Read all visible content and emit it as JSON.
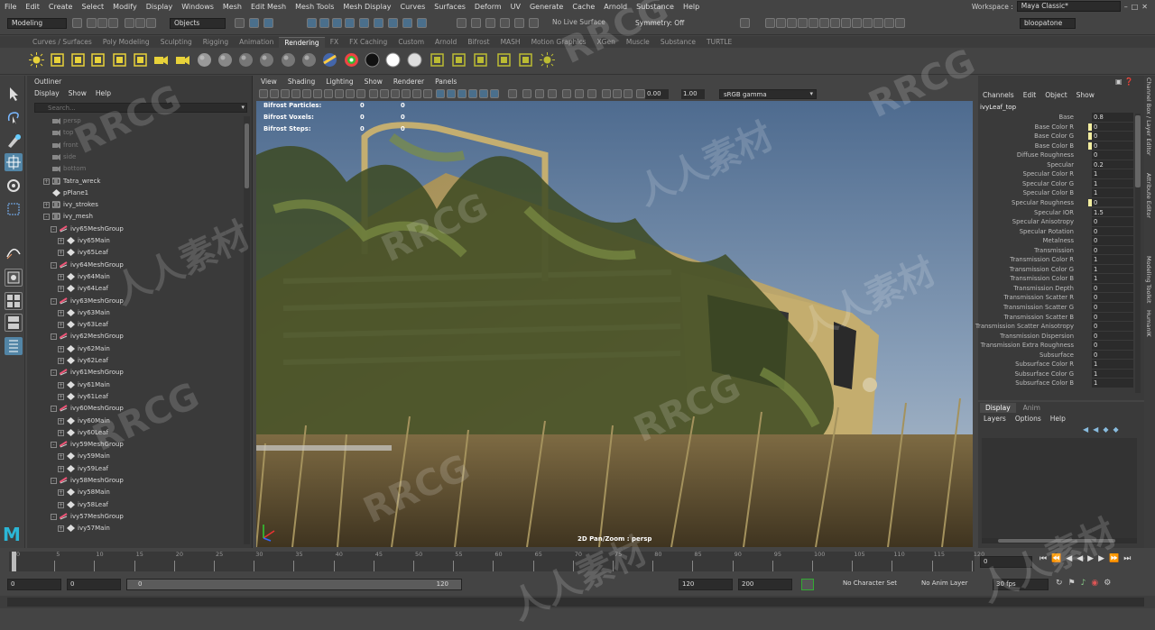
{
  "menus": [
    "File",
    "Edit",
    "Create",
    "Select",
    "Modify",
    "Display",
    "Windows",
    "Mesh",
    "Edit Mesh",
    "Mesh Tools",
    "Mesh Display",
    "Curves",
    "Surfaces",
    "Deform",
    "UV",
    "Generate",
    "Cache",
    "Arnold",
    "Substance",
    "Help"
  ],
  "workspace": {
    "label": "Workspace :",
    "value": "Maya Classic*"
  },
  "status": {
    "mode": "Modeling",
    "objects": "Objects",
    "live_surface": "No Live Surface",
    "symmetry": "Symmetry: Off",
    "user": "bloopatone"
  },
  "shelf_tabs": [
    "Curves / Surfaces",
    "Poly Modeling",
    "Sculpting",
    "Rigging",
    "Animation",
    "Rendering",
    "FX",
    "FX Caching",
    "Custom",
    "Arnold",
    "Bifrost",
    "MASH",
    "Motion Graphics",
    "XGen",
    "Muscle",
    "Substance",
    "TURTLE"
  ],
  "active_shelf_tab": "Rendering",
  "outliner": {
    "title": "Outliner",
    "menus": [
      "Display",
      "Show",
      "Help"
    ],
    "search_placeholder": "Search...",
    "items": [
      {
        "label": "persp",
        "depth": 0,
        "kind": "camera",
        "dim": true
      },
      {
        "label": "top",
        "depth": 0,
        "kind": "camera",
        "dim": true
      },
      {
        "label": "front",
        "depth": 0,
        "kind": "camera",
        "dim": true
      },
      {
        "label": "side",
        "depth": 0,
        "kind": "camera",
        "dim": true
      },
      {
        "label": "bottom",
        "depth": 0,
        "kind": "camera",
        "dim": true
      },
      {
        "label": "Tatra_wreck",
        "depth": 0,
        "kind": "group",
        "exp": "+"
      },
      {
        "label": "pPlane1",
        "depth": 0,
        "kind": "mesh"
      },
      {
        "label": "ivy_strokes",
        "depth": 0,
        "kind": "group",
        "exp": "+"
      },
      {
        "label": "ivy_mesh",
        "depth": 0,
        "kind": "group",
        "exp": "-"
      },
      {
        "label": "ivy65MeshGroup",
        "depth": 1,
        "kind": "meshgroup",
        "exp": "-"
      },
      {
        "label": "ivy65Main",
        "depth": 2,
        "kind": "mesh",
        "exp": "+"
      },
      {
        "label": "ivy65Leaf",
        "depth": 2,
        "kind": "mesh",
        "exp": "+"
      },
      {
        "label": "ivy64MeshGroup",
        "depth": 1,
        "kind": "meshgroup",
        "exp": "-"
      },
      {
        "label": "ivy64Main",
        "depth": 2,
        "kind": "mesh",
        "exp": "+"
      },
      {
        "label": "ivy64Leaf",
        "depth": 2,
        "kind": "mesh",
        "exp": "+"
      },
      {
        "label": "ivy63MeshGroup",
        "depth": 1,
        "kind": "meshgroup",
        "exp": "-"
      },
      {
        "label": "ivy63Main",
        "depth": 2,
        "kind": "mesh",
        "exp": "+"
      },
      {
        "label": "ivy63Leaf",
        "depth": 2,
        "kind": "mesh",
        "exp": "+"
      },
      {
        "label": "ivy62MeshGroup",
        "depth": 1,
        "kind": "meshgroup",
        "exp": "-"
      },
      {
        "label": "ivy62Main",
        "depth": 2,
        "kind": "mesh",
        "exp": "+"
      },
      {
        "label": "ivy62Leaf",
        "depth": 2,
        "kind": "mesh",
        "exp": "+"
      },
      {
        "label": "ivy61MeshGroup",
        "depth": 1,
        "kind": "meshgroup",
        "exp": "-"
      },
      {
        "label": "ivy61Main",
        "depth": 2,
        "kind": "mesh",
        "exp": "+"
      },
      {
        "label": "ivy61Leaf",
        "depth": 2,
        "kind": "mesh",
        "exp": "+"
      },
      {
        "label": "ivy60MeshGroup",
        "depth": 1,
        "kind": "meshgroup",
        "exp": "-"
      },
      {
        "label": "ivy60Main",
        "depth": 2,
        "kind": "mesh",
        "exp": "+"
      },
      {
        "label": "ivy60Leaf",
        "depth": 2,
        "kind": "mesh",
        "exp": "+"
      },
      {
        "label": "ivy59MeshGroup",
        "depth": 1,
        "kind": "meshgroup",
        "exp": "-"
      },
      {
        "label": "ivy59Main",
        "depth": 2,
        "kind": "mesh",
        "exp": "+"
      },
      {
        "label": "ivy59Leaf",
        "depth": 2,
        "kind": "mesh",
        "exp": "+"
      },
      {
        "label": "ivy58MeshGroup",
        "depth": 1,
        "kind": "meshgroup",
        "exp": "-"
      },
      {
        "label": "ivy58Main",
        "depth": 2,
        "kind": "mesh",
        "exp": "+"
      },
      {
        "label": "ivy58Leaf",
        "depth": 2,
        "kind": "mesh",
        "exp": "+"
      },
      {
        "label": "ivy57MeshGroup",
        "depth": 1,
        "kind": "meshgroup",
        "exp": "-"
      },
      {
        "label": "ivy57Main",
        "depth": 2,
        "kind": "mesh",
        "exp": "+"
      }
    ]
  },
  "viewport": {
    "menus": [
      "View",
      "Shading",
      "Lighting",
      "Show",
      "Renderer",
      "Panels"
    ],
    "value_a": "0.00",
    "value_b": "1.00",
    "color_space": "sRGB gamma",
    "hud": [
      {
        "label": "Bifrost Particles:",
        "v1": "0",
        "v2": "0"
      },
      {
        "label": "Bifrost Voxels:",
        "v1": "0",
        "v2": "0"
      },
      {
        "label": "Bifrost Steps:",
        "v1": "0",
        "v2": "0"
      }
    ],
    "camera_label": "2D Pan/Zoom : persp"
  },
  "channel_box": {
    "menus": [
      "Channels",
      "Edit",
      "Object",
      "Show"
    ],
    "object": "ivyLeaf_top",
    "rows": [
      {
        "name": "Base",
        "value": "0.8"
      },
      {
        "name": "Base Color R",
        "value": "0",
        "swatch": "#f3eea0"
      },
      {
        "name": "Base Color G",
        "value": "0",
        "swatch": "#f3eea0"
      },
      {
        "name": "Base Color B",
        "value": "0",
        "swatch": "#f3eea0"
      },
      {
        "name": "Diffuse Roughness",
        "value": "0"
      },
      {
        "name": "Specular",
        "value": "0.2"
      },
      {
        "name": "Specular Color R",
        "value": "1"
      },
      {
        "name": "Specular Color G",
        "value": "1"
      },
      {
        "name": "Specular Color B",
        "value": "1"
      },
      {
        "name": "Specular Roughness",
        "value": "0",
        "swatch": "#f3eea0"
      },
      {
        "name": "Specular IOR",
        "value": "1.5"
      },
      {
        "name": "Specular Anisotropy",
        "value": "0"
      },
      {
        "name": "Specular Rotation",
        "value": "0"
      },
      {
        "name": "Metalness",
        "value": "0"
      },
      {
        "name": "Transmission",
        "value": "0"
      },
      {
        "name": "Transmission Color R",
        "value": "1"
      },
      {
        "name": "Transmission Color G",
        "value": "1"
      },
      {
        "name": "Transmission Color B",
        "value": "1"
      },
      {
        "name": "Transmission Depth",
        "value": "0"
      },
      {
        "name": "Transmission Scatter R",
        "value": "0"
      },
      {
        "name": "Transmission Scatter G",
        "value": "0"
      },
      {
        "name": "Transmission Scatter B",
        "value": "0"
      },
      {
        "name": "Transmission Scatter Anisotropy",
        "value": "0"
      },
      {
        "name": "Transmission Dispersion",
        "value": "0"
      },
      {
        "name": "Transmission Extra Roughness",
        "value": "0"
      },
      {
        "name": "Subsurface",
        "value": "0"
      },
      {
        "name": "Subsurface Color R",
        "value": "1"
      },
      {
        "name": "Subsurface Color G",
        "value": "1"
      },
      {
        "name": "Subsurface Color B",
        "value": "1"
      }
    ]
  },
  "layer_editor": {
    "tabs": [
      "Display",
      "Anim"
    ],
    "menus": [
      "Layers",
      "Options",
      "Help"
    ]
  },
  "side_tabs": [
    "Channel Box / Layer Editor",
    "Attribute Editor",
    "Modeling Toolkit",
    "HumanIK"
  ],
  "timeline": {
    "ticks": [
      "0",
      "5",
      "10",
      "15",
      "20",
      "25",
      "30",
      "35",
      "40",
      "45",
      "50",
      "55",
      "60",
      "65",
      "70",
      "75",
      "80",
      "85",
      "90",
      "95",
      "100",
      "105",
      "110",
      "115",
      "120"
    ],
    "current": "0"
  },
  "range": {
    "start": "0",
    "inner_start": "0",
    "slider_start": "0",
    "slider_end": "120",
    "inner_end": "120",
    "end": "200",
    "character_set": "No Character Set",
    "anim_layer": "No Anim Layer",
    "fps": "30 fps"
  },
  "watermarks": [
    "RRCG",
    "人人素材"
  ]
}
